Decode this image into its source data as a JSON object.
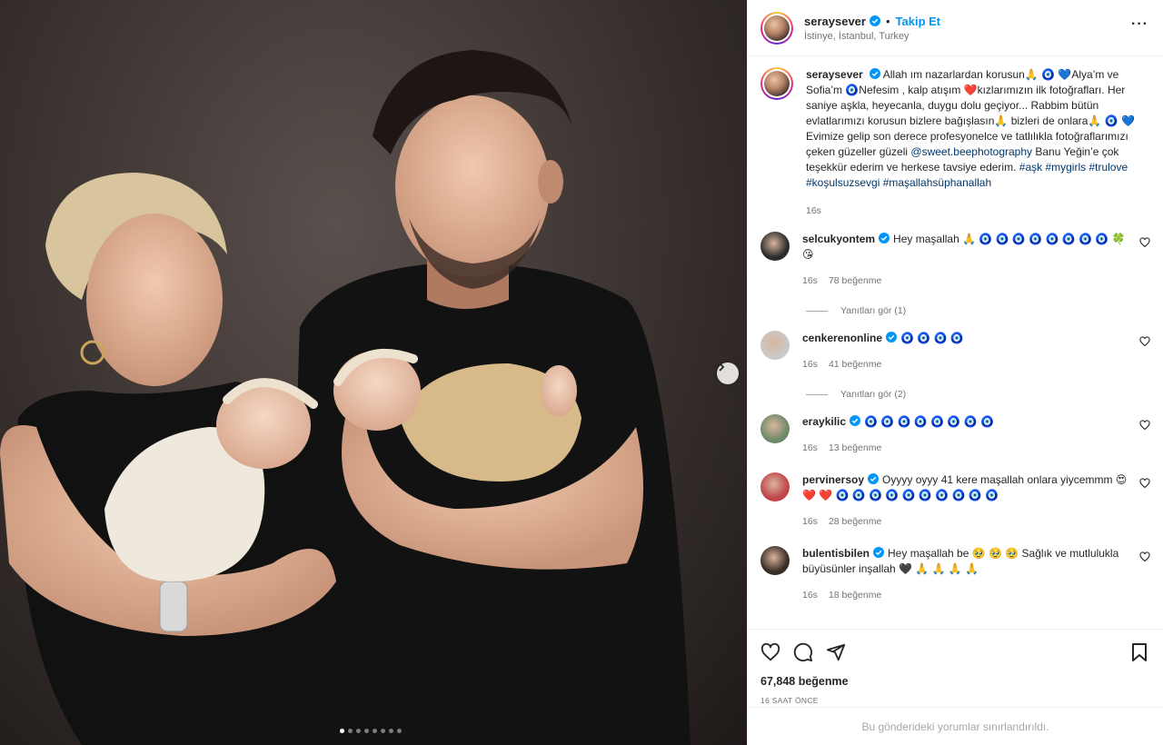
{
  "post": {
    "username": "seraysever",
    "follow_label": "Takip Et",
    "bullet": "•",
    "location": "İstinye, İstanbul, Turkey",
    "more_label": "···",
    "caption_segments": [
      "Allah ım nazarlardan korusun🙏 🧿 💙Alya’m ve Sofia’m  🧿Nefesim , kalp atışım ❤️kızlarımızın ilk fotoğrafları. Her saniye aşkla, heyecanla, duygu dolu geçiyor... Rabbim bütün evlatlarımızı korusun bizlere bağışlasın🙏 bizleri de onlara🙏 🧿 💙 Evimize gelip son derece profesyonelce ve tatlılıkla fotoğraflarımızı çeken güzeller güzeli ",
      "@sweet.beephotography",
      " Banu Yeğin’e çok teşekkür ederim ve herkese tavsiye ederim. ",
      "#aşk #mygirls #trulove #koşulsuzsevgi #maşallahsüphanallah"
    ],
    "caption_time": "16s",
    "likes": "67,848 beğenme",
    "time_ago": "16 SAAT ÖNCE",
    "comments_restricted": "Bu gönderideki yorumlar sınırlandırıldı."
  },
  "comments": [
    {
      "username": "selcukyontem",
      "text": "Hey maşallah 🙏 🧿 🧿 🧿 🧿 🧿 🧿 🧿 🧿 🍀 😘",
      "time": "16s",
      "likes": "78 beğenme",
      "replies": "Yanıtları gör (1)"
    },
    {
      "username": "cenkerenonline",
      "text": "🧿 🧿 🧿 🧿",
      "time": "16s",
      "likes": "41 beğenme",
      "replies": "Yanıtları gör (2)"
    },
    {
      "username": "eraykilic",
      "text": "🧿 🧿 🧿 🧿 🧿 🧿 🧿 🧿",
      "time": "16s",
      "likes": "13 beğenme",
      "replies": ""
    },
    {
      "username": "pervinersoy",
      "text": "Oyyyy oyyy 41 kere maşallah onlara yiycemmm 😍 ❤️ ❤️ 🧿 🧿 🧿 🧿 🧿 🧿 🧿 🧿 🧿 🧿",
      "time": "16s",
      "likes": "28 beğenme",
      "replies": ""
    },
    {
      "username": "bulentisbilen",
      "text": "Hey maşallah be 🥹 🥹 🥹 Sağlık ve mutlulukla büyüsünler inşallah 🖤 🙏 🙏 🙏 🙏",
      "time": "16s",
      "likes": "18 beğenme",
      "replies": ""
    }
  ],
  "carousel": {
    "total": 8,
    "active_index": 0
  },
  "colors": {
    "accent": "#0095f6",
    "link": "#00376b",
    "verified": "#0095f6"
  }
}
